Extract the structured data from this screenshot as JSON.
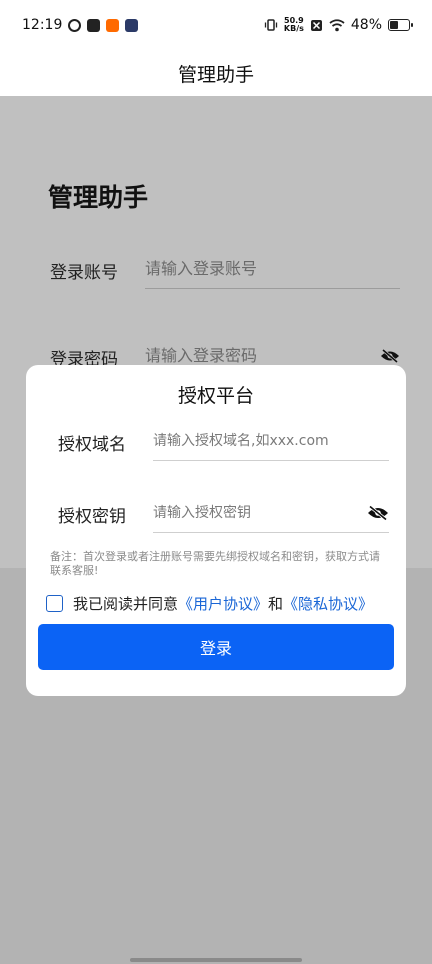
{
  "status_bar": {
    "time": "12:19",
    "net_speed_value": "50.9",
    "net_speed_unit": "KB/s",
    "battery": "48%"
  },
  "header": {
    "title": "管理助手"
  },
  "background_form": {
    "title": "管理助手",
    "account_label": "登录账号",
    "account_placeholder": "请输入登录账号",
    "password_label": "登录密码",
    "password_placeholder": "请输入登录密码"
  },
  "dialog": {
    "title": "授权平台",
    "domain_label": "授权域名",
    "domain_placeholder": "请输入授权域名,如xxx.com",
    "key_label": "授权密钥",
    "key_placeholder": "请输入授权密钥",
    "note": "备注：首次登录或者注册账号需要先绑授权域名和密钥，获取方式请联系客服!",
    "agree_prefix": "我已阅读并同意",
    "user_agreement": "《用户协议》",
    "agree_and": "和",
    "privacy_agreement": "《隐私协议》",
    "login_button": "登录"
  },
  "colors": {
    "primary": "#0b63f5",
    "link": "#1a66d6",
    "overlay": "#b3b3b3"
  }
}
